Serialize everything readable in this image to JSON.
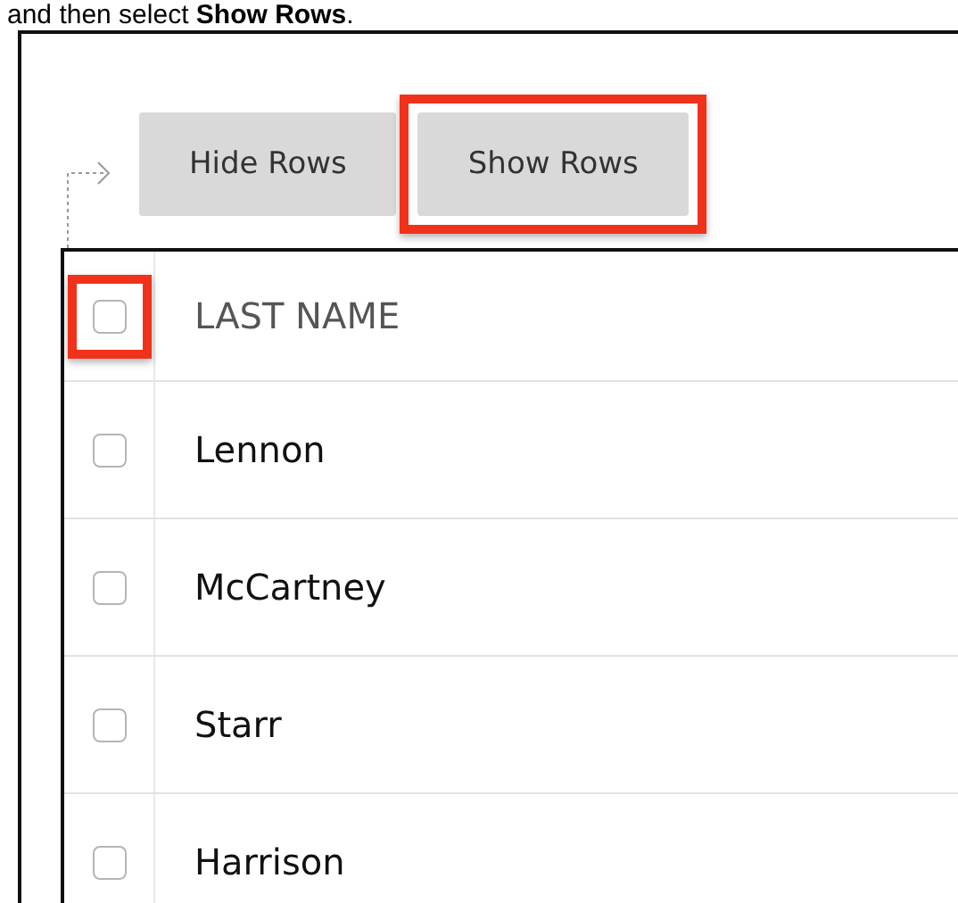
{
  "instruction": "and then select **Show Rows**.",
  "buttons": [
    {
      "label": "Hide Rows",
      "highlighted": false
    },
    {
      "label": "Show Rows",
      "highlighted": true
    }
  ],
  "table": {
    "header": {
      "label": "LAST NAME",
      "checked": false,
      "highlighted": true
    },
    "rows": [
      {
        "name": "Lennon",
        "checked": false
      },
      {
        "name": "McCartney",
        "checked": false
      },
      {
        "name": "Starr",
        "checked": false
      },
      {
        "name": "Harrison",
        "checked": false
      }
    ]
  }
}
